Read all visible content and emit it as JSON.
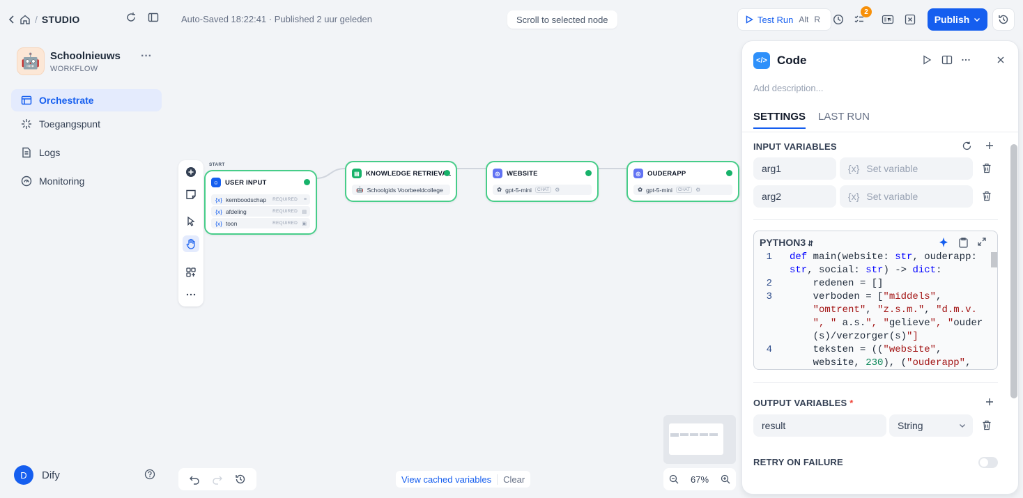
{
  "sidebar": {
    "breadcrumb_label": "STUDIO",
    "app_name": "Schoolnieuws",
    "app_type": "WORKFLOW",
    "nav": [
      {
        "label": "Orchestrate",
        "active": true
      },
      {
        "label": "Toegangspunt",
        "active": false
      },
      {
        "label": "Logs",
        "active": false
      },
      {
        "label": "Monitoring",
        "active": false
      }
    ],
    "user": {
      "initial": "D",
      "name": "Dify"
    }
  },
  "header": {
    "status": "Auto-Saved 18:22:41 · Published 2 uur geleden",
    "scroll_button": "Scroll to selected node",
    "test_run": {
      "label": "Test Run",
      "kbd1": "Alt",
      "kbd2": "R"
    },
    "checklist_badge": "2",
    "publish_label": "Publish"
  },
  "canvas": {
    "start_label": "START",
    "nodes": {
      "user_input": {
        "title": "USER INPUT",
        "vars": [
          {
            "name": "kernboodschap",
            "req": "REQUIRED"
          },
          {
            "name": "afdeling",
            "req": "REQUIRED"
          },
          {
            "name": "toon",
            "req": "REQUIRED"
          }
        ]
      },
      "knowledge": {
        "title": "KNOWLEDGE RETRIEVAL",
        "dataset": "Schoolgids Voorbeeldcollege"
      },
      "website": {
        "title": "WEBSITE",
        "model": "gpt-5-mini",
        "mode": "CHAT"
      },
      "ouderapp": {
        "title": "OUDERAPP",
        "model": "gpt-5-mini",
        "mode": "CHAT"
      }
    },
    "cached_vars_label": "View cached variables",
    "clear_label": "Clear",
    "zoom": "67%"
  },
  "panel": {
    "title": "Code",
    "description_placeholder": "Add description...",
    "tabs": [
      "SETTINGS",
      "LAST RUN"
    ],
    "input_section": "INPUT VARIABLES",
    "inputs": [
      {
        "name": "arg1",
        "placeholder": "Set variable"
      },
      {
        "name": "arg2",
        "placeholder": "Set variable"
      }
    ],
    "language": "PYTHON3",
    "output_section": "OUTPUT VARIABLES",
    "outputs": [
      {
        "name": "result",
        "type": "String"
      }
    ],
    "retry_section": "RETRY ON FAILURE",
    "code_lines": [
      {
        "n": "1",
        "t": "def main(website: str, ouderapp:"
      },
      {
        "n": "",
        "t": "str, social: str) -> dict:"
      },
      {
        "n": "2",
        "t": "    redenen = []"
      },
      {
        "n": "3",
        "t": "    verboden = [\"middels\","
      },
      {
        "n": "",
        "t": "    \"omtrent\", \"z.s.m.\", \"d.m.v."
      },
      {
        "n": "",
        "t": "    \", \" a.s.\", \"gelieve\", \"ouder"
      },
      {
        "n": "",
        "t": "    (s)/verzorger(s)\"]"
      },
      {
        "n": "4",
        "t": "    teksten = ((\"website\","
      },
      {
        "n": "",
        "t": "    website, 230), (\"ouderapp\","
      }
    ]
  },
  "colors": {
    "accent": "#155eef",
    "success": "#17b26a",
    "node_border": "#47cd89"
  }
}
